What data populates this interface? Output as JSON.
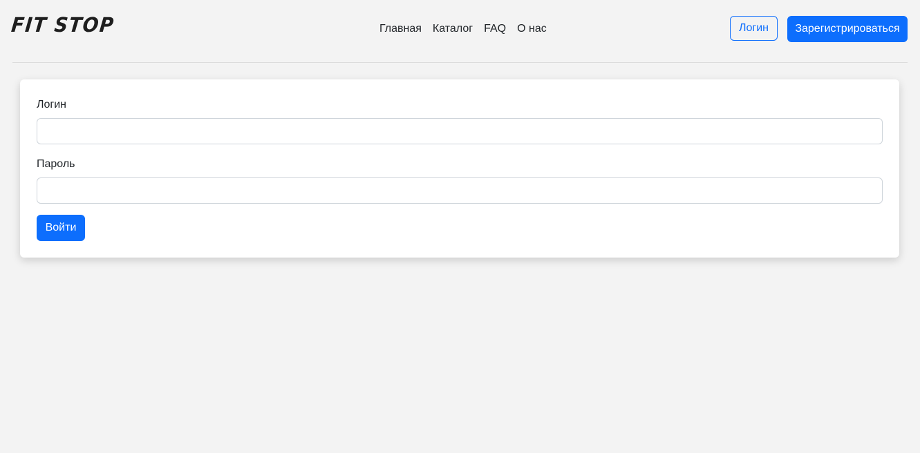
{
  "header": {
    "logo_text": "FIT STOP",
    "nav": [
      {
        "label": "Главная"
      },
      {
        "label": "Каталог"
      },
      {
        "label": "FAQ"
      },
      {
        "label": "О нас"
      }
    ],
    "login_button": "Логин",
    "register_button": "Зарегистрироваться"
  },
  "form": {
    "login_label": "Логин",
    "login_value": "",
    "password_label": "Пароль",
    "password_value": "",
    "submit_button": "Войти"
  },
  "colors": {
    "primary": "#0d6efd",
    "background": "#f3f3f3",
    "card": "#ffffff",
    "text": "#212529"
  }
}
